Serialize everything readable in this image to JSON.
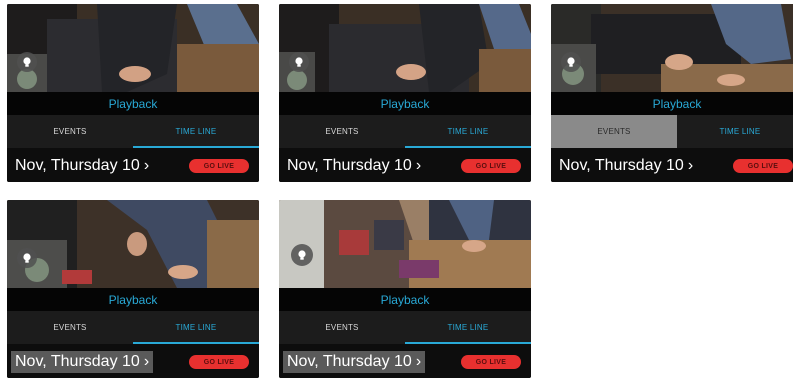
{
  "panels": [
    {
      "playback_label": "Playback",
      "tab_events": "EVENTS",
      "tab_timeline": "TIME LINE",
      "date": "Nov, Thursday 10",
      "chevron": "›",
      "go_live": "GO LIVE",
      "selected_tab": "timeline",
      "date_highlighted": false
    },
    {
      "playback_label": "Playback",
      "tab_events": "EVENTS",
      "tab_timeline": "TIME LINE",
      "date": "Nov, Thursday 10",
      "chevron": "›",
      "go_live": "GO LIVE",
      "selected_tab": "timeline",
      "date_highlighted": false
    },
    {
      "playback_label": "Playback",
      "tab_events": "EVENTS",
      "tab_timeline": "TIME LINE",
      "date": "Nov, Thursday 10",
      "chevron": "›",
      "go_live": "GO LIVE",
      "selected_tab": "events-pressed",
      "date_highlighted": false
    },
    {
      "playback_label": "Playback",
      "tab_events": "EVENTS",
      "tab_timeline": "TIME LINE",
      "date": "Nov, Thursday 10",
      "chevron": "›",
      "go_live": "GO LIVE",
      "selected_tab": "timeline",
      "date_highlighted": true
    },
    {
      "playback_label": "Playback",
      "tab_events": "EVENTS",
      "tab_timeline": "TIME LINE",
      "date": "Nov, Thursday 10",
      "chevron": "›",
      "go_live": "GO LIVE",
      "selected_tab": "timeline",
      "date_highlighted": true
    }
  ],
  "icons": {
    "light": "light-bulb-icon"
  },
  "colors": {
    "accent": "#29a9d6",
    "go_live": "#e8302f",
    "background": "#0d0d0d"
  }
}
